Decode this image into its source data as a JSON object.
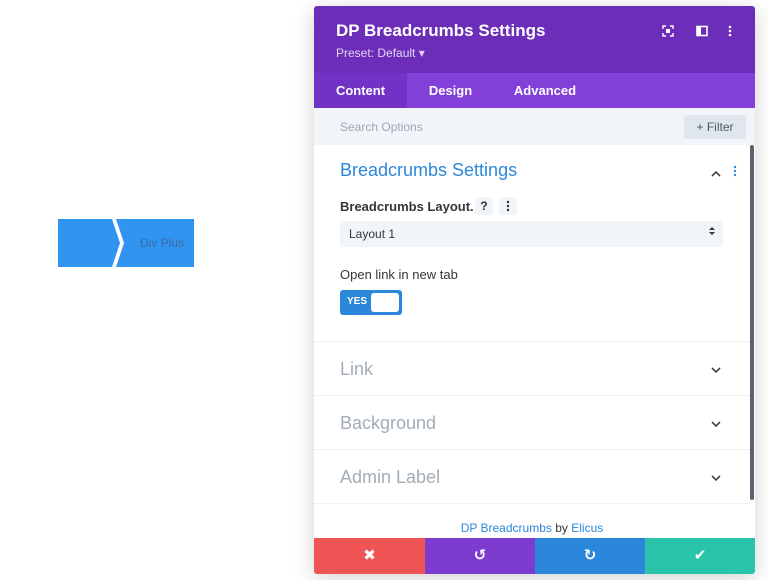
{
  "preview": {
    "breadcrumb_current": "Div Plus",
    "colors": {
      "crumb": "#2f95f1",
      "current_text": "#3c6aa0"
    }
  },
  "modal": {
    "title": "DP Breadcrumbs Settings",
    "preset": "Preset: Default ▾",
    "header_icons": [
      "focus-icon",
      "split-view-icon",
      "more-vertical-icon"
    ],
    "tabs": [
      {
        "label": "Content",
        "active": true
      },
      {
        "label": "Design",
        "active": false
      },
      {
        "label": "Advanced",
        "active": false
      }
    ],
    "search": {
      "placeholder": "Search Options"
    },
    "filter_label": "+ Filter",
    "section": {
      "title": "Breadcrumbs Settings",
      "layout_label": "Breadcrumbs Layout.",
      "help_glyph": "?",
      "layout_value": "Layout 1",
      "newtab_label": "Open link in new tab",
      "toggle_label": "YES",
      "toggle_on": true
    },
    "collapsed_sections": [
      "Link",
      "Background",
      "Admin Label"
    ],
    "credit": {
      "plugin": "DP Breadcrumbs",
      "by": "by",
      "author": "Elicus"
    },
    "footer_buttons": [
      {
        "name": "discard",
        "glyph": "✖",
        "color": "#ef5555"
      },
      {
        "name": "undo",
        "glyph": "↺",
        "color": "#7d3bcf"
      },
      {
        "name": "redo",
        "glyph": "↻",
        "color": "#2b87da"
      },
      {
        "name": "save",
        "glyph": "✔",
        "color": "#29c4a9"
      }
    ],
    "colors": {
      "header": "#6c2eb9",
      "tabs": "#8240d8",
      "accent": "#2b87da"
    }
  }
}
